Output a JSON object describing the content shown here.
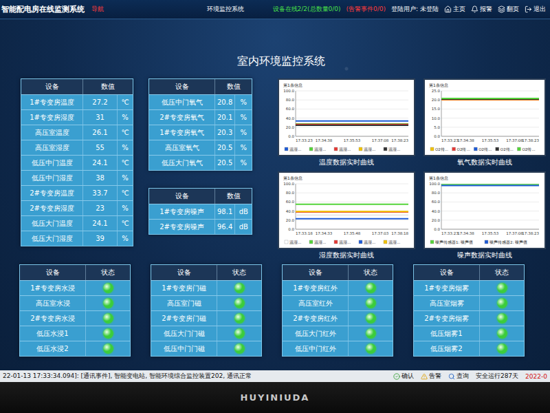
{
  "header": {
    "title": "智能配电房在线监测系统",
    "nav": "导航",
    "page": "环境监控系统",
    "online": "设备在线2/2(总数量0/0)",
    "alarm": "(告警事件0/0)",
    "user": "登陆用户: 未登陆",
    "buttons": [
      {
        "label": "主页"
      },
      {
        "label": "报警"
      },
      {
        "label": "翻页"
      },
      {
        "label": "退出"
      }
    ]
  },
  "title": "室内环境监控系统",
  "env_table": {
    "columns": [
      "设备",
      "数值"
    ],
    "rows": [
      {
        "name": "1#专变房温度",
        "value": "27.2",
        "unit": "℃"
      },
      {
        "name": "1#专变房湿度",
        "value": "31",
        "unit": "%"
      },
      {
        "name": "高压室温度",
        "value": "26.1",
        "unit": "℃"
      },
      {
        "name": "高压室湿度",
        "value": "55",
        "unit": "%"
      },
      {
        "name": "低压中门温度",
        "value": "24.1",
        "unit": "℃"
      },
      {
        "name": "低压中门湿度",
        "value": "38",
        "unit": "%"
      },
      {
        "name": "2#专变房温度",
        "value": "33.7",
        "unit": "℃"
      },
      {
        "name": "2#专变房湿度",
        "value": "23",
        "unit": "%"
      },
      {
        "name": "低压大门温度",
        "value": "24.1",
        "unit": "℃"
      },
      {
        "name": "低压大门湿度",
        "value": "39",
        "unit": "%"
      }
    ]
  },
  "oxygen_table": {
    "columns": [
      "设备",
      "数值"
    ],
    "rows": [
      {
        "name": "低压中门氧气",
        "value": "20.8",
        "unit": "%"
      },
      {
        "name": "2#专变房氧气",
        "value": "20.1",
        "unit": "%"
      },
      {
        "name": "1#专变房氧气",
        "value": "20.3",
        "unit": "%"
      },
      {
        "name": "高压室氧气",
        "value": "20.5",
        "unit": "%"
      },
      {
        "name": "低压大门氧气",
        "value": "20.5",
        "unit": "%"
      }
    ]
  },
  "noise_table": {
    "columns": [
      "设备",
      "数值"
    ],
    "rows": [
      {
        "name": "1#专变房噪声",
        "value": "98.1",
        "unit": "dB"
      },
      {
        "name": "2#专变房噪声",
        "value": "96.4",
        "unit": "dB"
      }
    ]
  },
  "charts": [
    {
      "info": "第1条信息",
      "title": "温度数据实时曲线",
      "y_ticks": [
        "100.0",
        "80.0",
        "60.0",
        "40.0",
        "20.0",
        "0.0"
      ],
      "x_ticks": [
        "17:33:23",
        "17:34:38",
        "17:35:53",
        "17:37:08",
        "17:38:23"
      ],
      "series": [
        {
          "name": "温湿...",
          "color": "#1e5bd6",
          "values": [
            33.7,
            33.7,
            33.7,
            33.7,
            33.7
          ]
        },
        {
          "name": "温湿...",
          "color": "#55d43a",
          "values": [
            27.2,
            27.2,
            27.2,
            27.2,
            27.2
          ]
        },
        {
          "name": "温湿...",
          "color": "#e53935",
          "values": [
            26.1,
            26.1,
            26.1,
            26.1,
            26.1
          ]
        },
        {
          "name": "温湿...",
          "color": "#f2c200",
          "values": [
            24.1,
            24.1,
            24.1,
            24.1,
            24.1
          ]
        },
        {
          "name": "温湿...",
          "color": "#333333",
          "values": [
            24.1,
            24.1,
            24.1,
            24.1,
            24.1
          ]
        }
      ]
    },
    {
      "info": "第1条信息",
      "title": "氧气数据实时曲线",
      "y_ticks": [
        "25.0",
        "20.0",
        "15.0",
        "10.0",
        "5.0",
        "0.0"
      ],
      "x_ticks": [
        "17:33:23",
        "17:34:38",
        "17:35:53",
        "17:37:08",
        "17:38:23"
      ],
      "series": [
        {
          "name": "O2传...",
          "color": "#f2c200",
          "values": [
            20.1,
            20.1,
            20.1,
            20.1,
            20.1
          ]
        },
        {
          "name": "O2传...",
          "color": "#e53935",
          "values": [
            20.3,
            20.3,
            20.3,
            20.3,
            20.3
          ]
        },
        {
          "name": "O2传...",
          "color": "#1e5bd6",
          "values": [
            20.5,
            20.5,
            20.5,
            20.5,
            20.5
          ]
        },
        {
          "name": "O2传...",
          "color": "#333333",
          "values": [
            20.5,
            20.5,
            20.5,
            20.5,
            20.5
          ]
        },
        {
          "name": "O2传...",
          "color": "#55d43a",
          "values": [
            20.8,
            20.8,
            20.8,
            20.8,
            20.8
          ]
        }
      ]
    },
    {
      "info": "第1条信息",
      "title": "湿度数据实时曲线",
      "y_ticks": [
        "100.0",
        "80.0",
        "60.0",
        "40.0",
        "20.0",
        "0.0"
      ],
      "x_ticks": [
        "17:33:18",
        "17:34:33",
        "17:35:48",
        "17:37:03",
        "17:38:18"
      ],
      "series": [
        {
          "name": "温湿...",
          "color": "#ffffff",
          "values": [
            31,
            31,
            31,
            31,
            31
          ]
        },
        {
          "name": "温湿...",
          "color": "#55d43a",
          "values": [
            55,
            55,
            55,
            55,
            55
          ]
        },
        {
          "name": "温湿...",
          "color": "#e53935",
          "values": [
            38,
            38,
            38,
            38,
            38
          ]
        },
        {
          "name": "温湿...",
          "color": "#1e5bd6",
          "values": [
            23,
            23,
            23,
            23,
            23
          ]
        },
        {
          "name": "温湿...",
          "color": "#f2c200",
          "values": [
            39,
            39,
            39,
            39,
            39
          ]
        }
      ]
    },
    {
      "info": "第1条信息",
      "title": "噪声数据实时曲线",
      "y_ticks": [
        "100.0",
        "80.0",
        "60.0",
        "40.0",
        "20.0",
        "0.0"
      ],
      "x_ticks": [
        "17:33:23",
        "17:34:38",
        "17:35:53",
        "17:37:08",
        "17:38:23"
      ],
      "series": [
        {
          "name": "噪声传感器1: 噪声值",
          "color": "#55d43a",
          "values": [
            98.1,
            98.1,
            98.1,
            98.1,
            98.1
          ]
        },
        {
          "name": "噪声传感器2: 噪声值",
          "color": "#1e5bd6",
          "values": [
            96.4,
            96.4,
            96.4,
            96.4,
            96.4
          ]
        }
      ]
    }
  ],
  "status_panels": [
    {
      "columns": [
        "设备",
        "状态"
      ],
      "rows": [
        {
          "name": "1#专变房水浸",
          "normal": true,
          "color": "#3ccc3c"
        },
        {
          "name": "高压室水浸",
          "normal": true,
          "color": "#3ccc3c"
        },
        {
          "name": "2#专变房水浸",
          "normal": true,
          "color": "#3ccc3c"
        },
        {
          "name": "低压水浸1",
          "normal": true,
          "color": "#3ccc3c"
        },
        {
          "name": "低压水浸2",
          "normal": true,
          "color": "#3ccc3c"
        }
      ]
    },
    {
      "columns": [
        "设备",
        "状态"
      ],
      "rows": [
        {
          "name": "1#专变房门磁",
          "normal": true,
          "color": "#3ccc3c"
        },
        {
          "name": "高压室门磁",
          "normal": true,
          "color": "#3ccc3c"
        },
        {
          "name": "2#专变房门磁",
          "normal": true,
          "color": "#3ccc3c"
        },
        {
          "name": "低压大门门磁",
          "normal": true,
          "color": "#3ccc3c"
        },
        {
          "name": "低压中门门磁",
          "normal": true,
          "color": "#3ccc3c"
        }
      ]
    },
    {
      "columns": [
        "设备",
        "状态"
      ],
      "rows": [
        {
          "name": "1#专变房红外",
          "normal": true,
          "color": "#3ccc3c"
        },
        {
          "name": "高压室红外",
          "normal": true,
          "color": "#3ccc3c"
        },
        {
          "name": "2#专变房红外",
          "normal": true,
          "color": "#3ccc3c"
        },
        {
          "name": "低压大门红外",
          "normal": true,
          "color": "#3ccc3c"
        },
        {
          "name": "低压中门红外",
          "normal": true,
          "color": "#3ccc3c"
        }
      ]
    },
    {
      "columns": [
        "设备",
        "状态"
      ],
      "rows": [
        {
          "name": "1#专变房烟雾",
          "normal": true,
          "color": "#3ccc3c"
        },
        {
          "name": "高压室烟雾",
          "normal": true,
          "color": "#3ccc3c"
        },
        {
          "name": "2#专变房烟雾",
          "normal": true,
          "color": "#3ccc3c"
        },
        {
          "name": "低压烟雾1",
          "normal": true,
          "color": "#3ccc3c"
        },
        {
          "name": "低压烟雾2",
          "normal": true,
          "color": "#3ccc3c"
        }
      ]
    }
  ],
  "status_bar": {
    "event": "22-01-13 17:33:34.094]: [通讯事件], 智能变电站, 智能环境综合监控装置202, 通讯正常",
    "actions": [
      {
        "label": "确认"
      },
      {
        "label": "告警"
      },
      {
        "label": "查询"
      }
    ],
    "uptime": "安全运行287天",
    "date": "2022-0"
  },
  "monitor": {
    "brand": "HUYINIUDA"
  }
}
